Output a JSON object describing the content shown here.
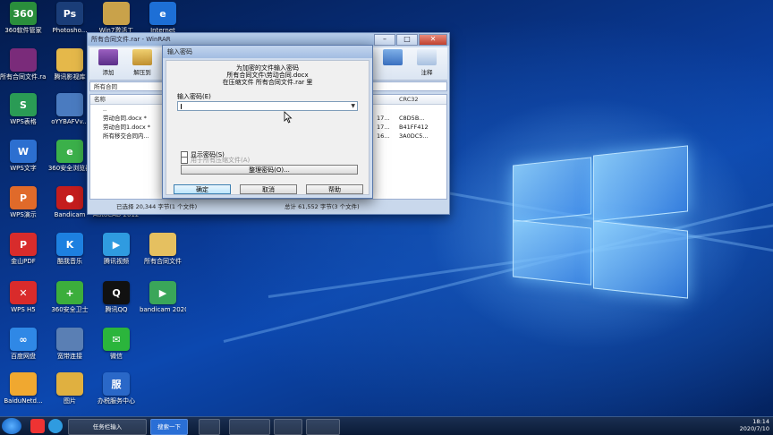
{
  "desktop_icons": [
    {
      "label": "360软件管家",
      "color": "#2a8e3c",
      "glyph": "360"
    },
    {
      "label": "Photosho...",
      "color": "#1a3d78",
      "glyph": "Ps"
    },
    {
      "label": "Win7激活工",
      "color": "#c9a24a",
      "glyph": ""
    },
    {
      "label": "Internet",
      "color": "#1d6fd6",
      "glyph": "e"
    },
    {
      "label": "所有合同文件.rar",
      "color": "#7a2b7a",
      "glyph": ""
    },
    {
      "label": "腾讯影视库",
      "color": "#e5b84a",
      "glyph": ""
    },
    {
      "label": "WPS表格",
      "color": "#2a9b55",
      "glyph": "S"
    },
    {
      "label": "oYYBAFVv...",
      "color": "#4a7bc0",
      "glyph": ""
    },
    {
      "label": "WPS文字",
      "color": "#2c6fd0",
      "glyph": "W"
    },
    {
      "label": "360安全浏览器",
      "color": "#3bb04a",
      "glyph": "e"
    },
    {
      "label": "WPS演示",
      "color": "#e06a2a",
      "glyph": "P"
    },
    {
      "label": "Bandicam",
      "color": "#c41d1d",
      "glyph": "●"
    },
    {
      "label": "AutoCAD 2012 - S...",
      "color": "#b53030",
      "glyph": ""
    },
    {
      "label": "金山PDF",
      "color": "#d82c2c",
      "glyph": "P"
    },
    {
      "label": "酷我音乐",
      "color": "#1d80e0",
      "glyph": "K"
    },
    {
      "label": "腾讯视频",
      "color": "#2f9be0",
      "glyph": "▶"
    },
    {
      "label": "所有合同文件",
      "color": "#e5c060",
      "glyph": ""
    },
    {
      "label": "WPS H5",
      "color": "#d92b2b",
      "glyph": "✕"
    },
    {
      "label": "360安全卫士",
      "color": "#3cae3c",
      "glyph": "+"
    },
    {
      "label": "腾讯QQ",
      "color": "#111111",
      "glyph": "Q"
    },
    {
      "label": "bandicam 2020-07-1...",
      "color": "#3aa65a",
      "glyph": "▶"
    },
    {
      "label": "百度网盘",
      "color": "#2f88e6",
      "glyph": "∞"
    },
    {
      "label": "宽带连接",
      "color": "#5a7fb4",
      "glyph": ""
    },
    {
      "label": "微信",
      "color": "#2bb53c",
      "glyph": "✉"
    },
    {
      "label": "BaiduNetd...",
      "color": "#f0a830",
      "glyph": ""
    },
    {
      "label": "图片",
      "color": "#e0b040",
      "glyph": ""
    },
    {
      "label": "办税服务中心",
      "color": "#2a68c8",
      "glyph": "服"
    }
  ],
  "winrar": {
    "title": "所有合同文件.rar - WinRAR",
    "toolbar": [
      "添加",
      "解压到",
      "注释"
    ],
    "address": "所有合同",
    "columns": {
      "name": "名称",
      "crc": "CRC32"
    },
    "rows": [
      {
        "name": "..",
        "date": "",
        "crc": ""
      },
      {
        "name": "劳动合同.docx *",
        "date": "17...",
        "crc": "C8D5B..."
      },
      {
        "name": "劳动合同1.docx *",
        "date": "17...",
        "crc": "B41FF412"
      },
      {
        "name": "所有移交合同内...",
        "date": "16...",
        "crc": "3A0DC5..."
      }
    ],
    "status_left": "已选择 20,344 字节(1 个文件)",
    "status_right": "总计 61,552 字节(3 个文件)"
  },
  "password_dialog": {
    "title": "输入密码",
    "message_lines": [
      "为加密的文件输入密码",
      "所有合同文件\\劳动合同.docx",
      "在压缩文件 所有合同文件.rar 里"
    ],
    "input_label": "输入密码(E)",
    "show_password": "显示密码(S)",
    "use_for_all": "用于所有压缩文件(A)",
    "organize_button": "整理密码(O)...",
    "ok": "确定",
    "cancel": "取消",
    "help": "帮助"
  },
  "taskbar": {
    "items": [
      "任务栏输入",
      "搜索一下"
    ],
    "time": "18:14",
    "date": "2020/7/10"
  }
}
